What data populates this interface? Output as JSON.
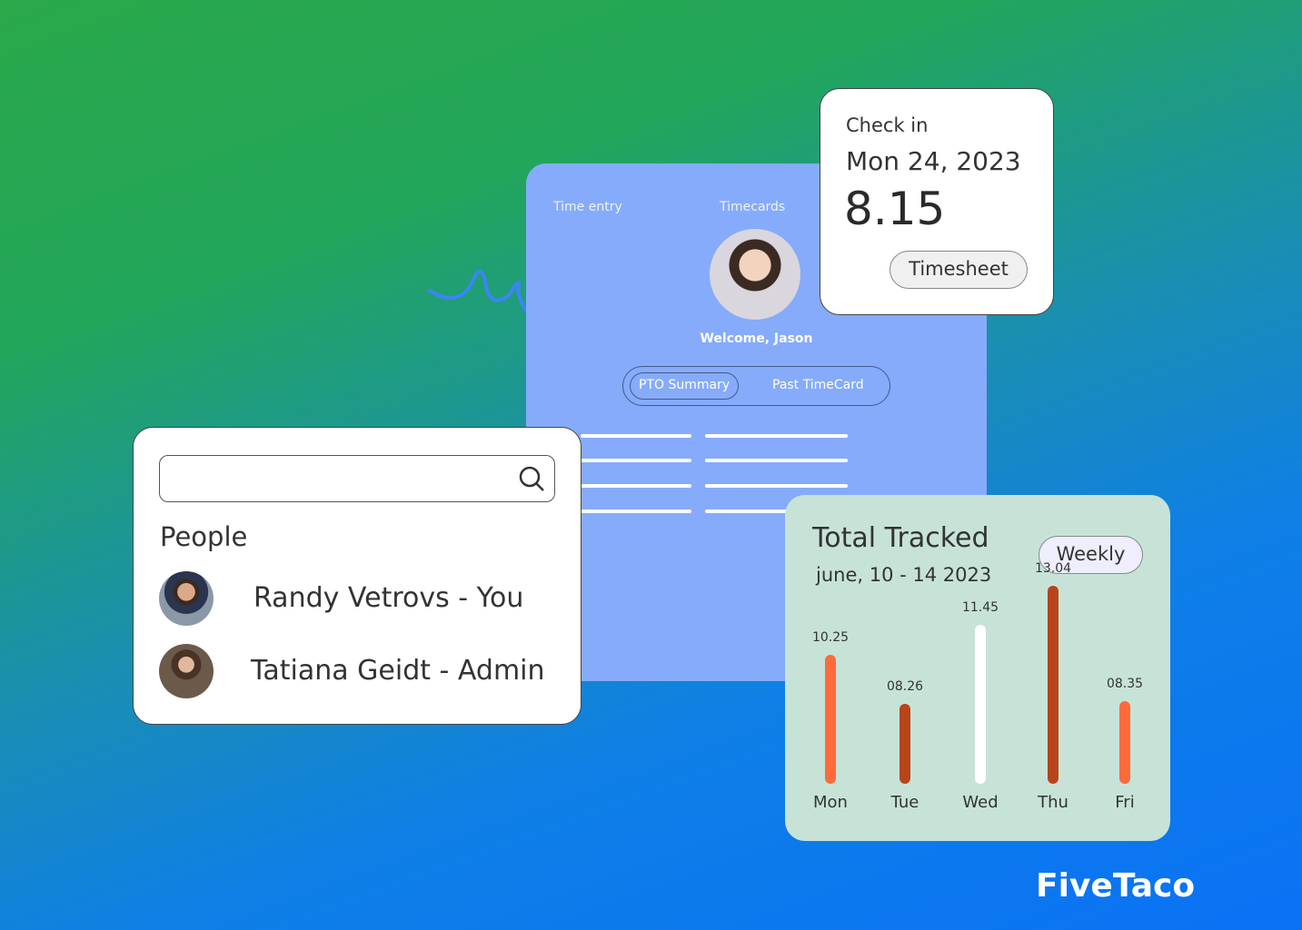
{
  "app": {
    "tabs": [
      "Time entry",
      "Timecards"
    ],
    "welcome": "Welcome, Jason",
    "segments": [
      "PTO Summary",
      "Past TimeCard"
    ]
  },
  "checkin": {
    "label": "Check in",
    "date": "Mon 24, 2023",
    "value": "8.15",
    "button": "Timesheet"
  },
  "people": {
    "search_placeholder": "",
    "heading": "People",
    "items": [
      {
        "name": "Randy Vetrovs - You"
      },
      {
        "name": "Tatiana Geidt - Admin"
      }
    ]
  },
  "tracked": {
    "title": "Total Tracked",
    "subtitle": "june, 10 - 14 2023",
    "period": "Weekly"
  },
  "chart_data": {
    "type": "bar",
    "categories": [
      "Mon",
      "Tue",
      "Wed",
      "Thu",
      "Fri"
    ],
    "values": [
      10.25,
      8.26,
      11.45,
      13.04,
      8.35
    ],
    "labels": [
      "10.25",
      "08.26",
      "11.45",
      "13.04",
      "08.35"
    ],
    "colors": [
      "#ff6a3a",
      "#b8451a",
      "#ffffff",
      "#b8451a",
      "#ff6a3a"
    ]
  },
  "brand": {
    "logo": "FiveTaco"
  }
}
